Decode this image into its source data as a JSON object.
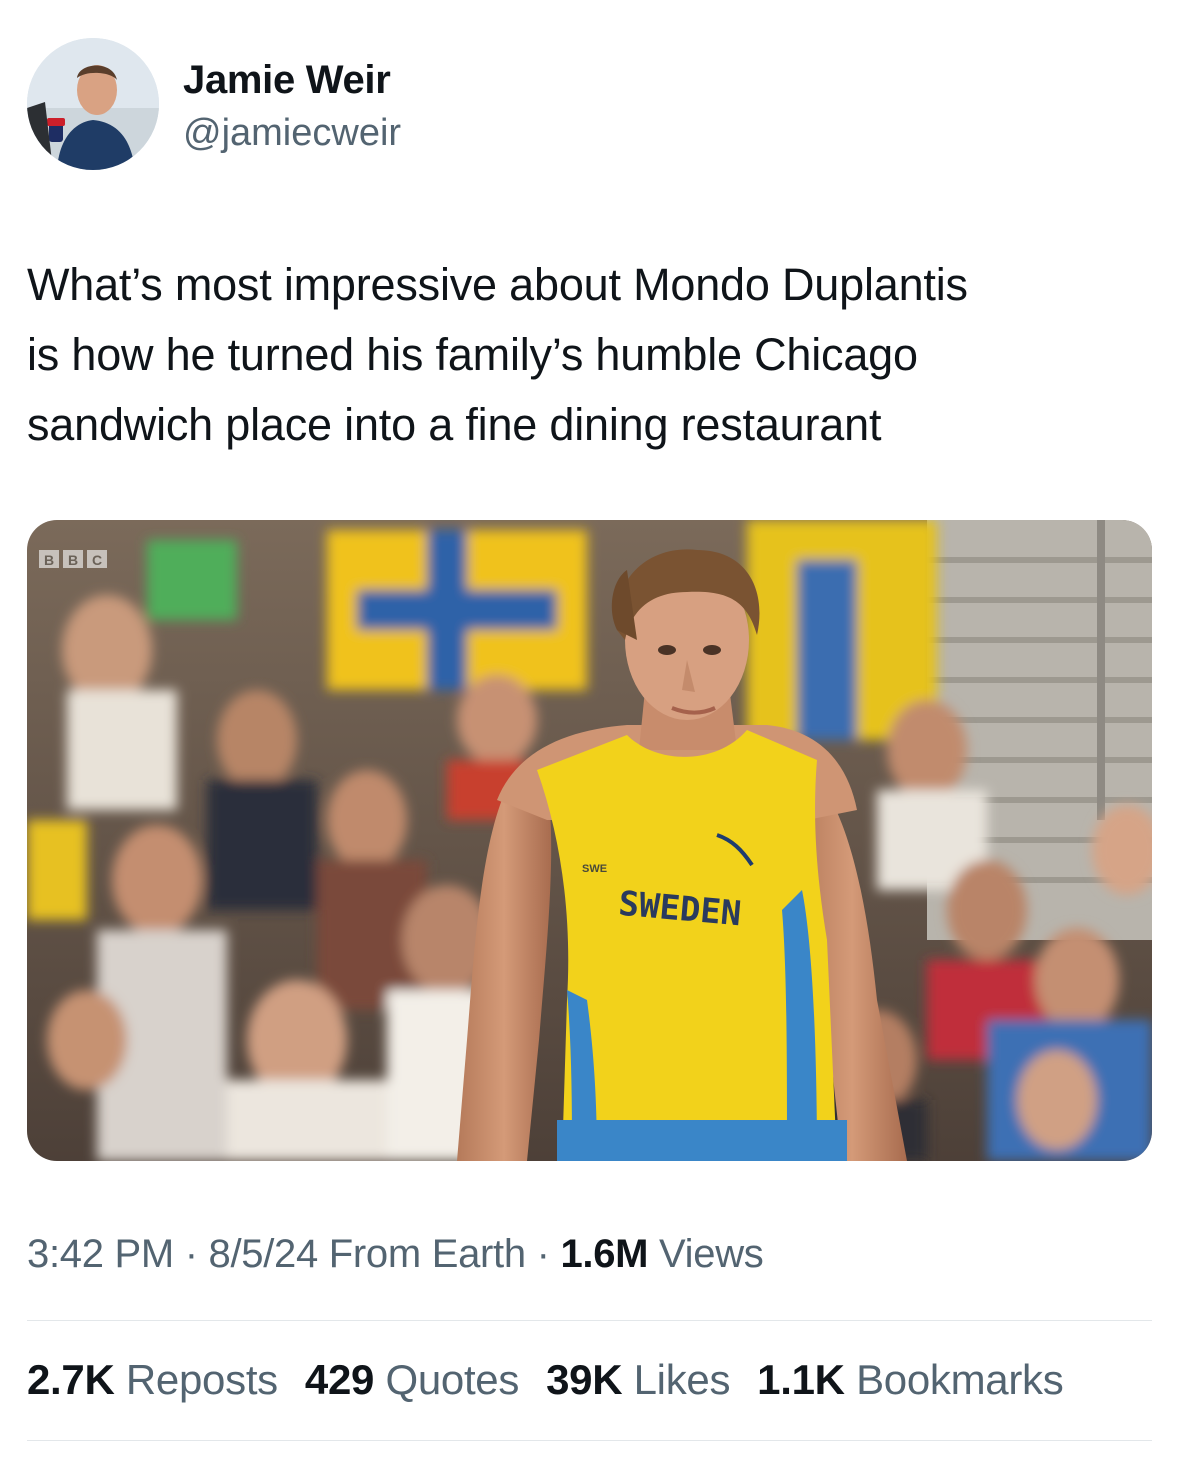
{
  "author": {
    "name": "Jamie Weir",
    "handle": "@jamiecweir"
  },
  "tweet": {
    "text_lines": [
      "What’s most impressive about Mondo Duplantis",
      "is how he turned his family’s humble Chicago",
      "sandwich place into a fine dining restaurant"
    ]
  },
  "media": {
    "broadcaster_logo": [
      "B",
      "B",
      "C"
    ],
    "jersey_text": "SWEDEN",
    "jersey_badge": "SWE"
  },
  "meta": {
    "time": "3:42 PM",
    "sep1": " · ",
    "date": "8/5/24",
    "source": " From Earth",
    "sep2": " · ",
    "views_count": "1.6M",
    "views_label": " Views"
  },
  "stats": [
    {
      "count": "2.7K",
      "label": "Reposts"
    },
    {
      "count": "429",
      "label": "Quotes"
    },
    {
      "count": "39K",
      "label": "Likes"
    },
    {
      "count": "1.1K",
      "label": "Bookmarks"
    }
  ],
  "colors": {
    "text": "#0f1419",
    "secondary": "#536471",
    "jersey_yellow": "#f2d21b",
    "jersey_blue": "#3a86c8"
  }
}
